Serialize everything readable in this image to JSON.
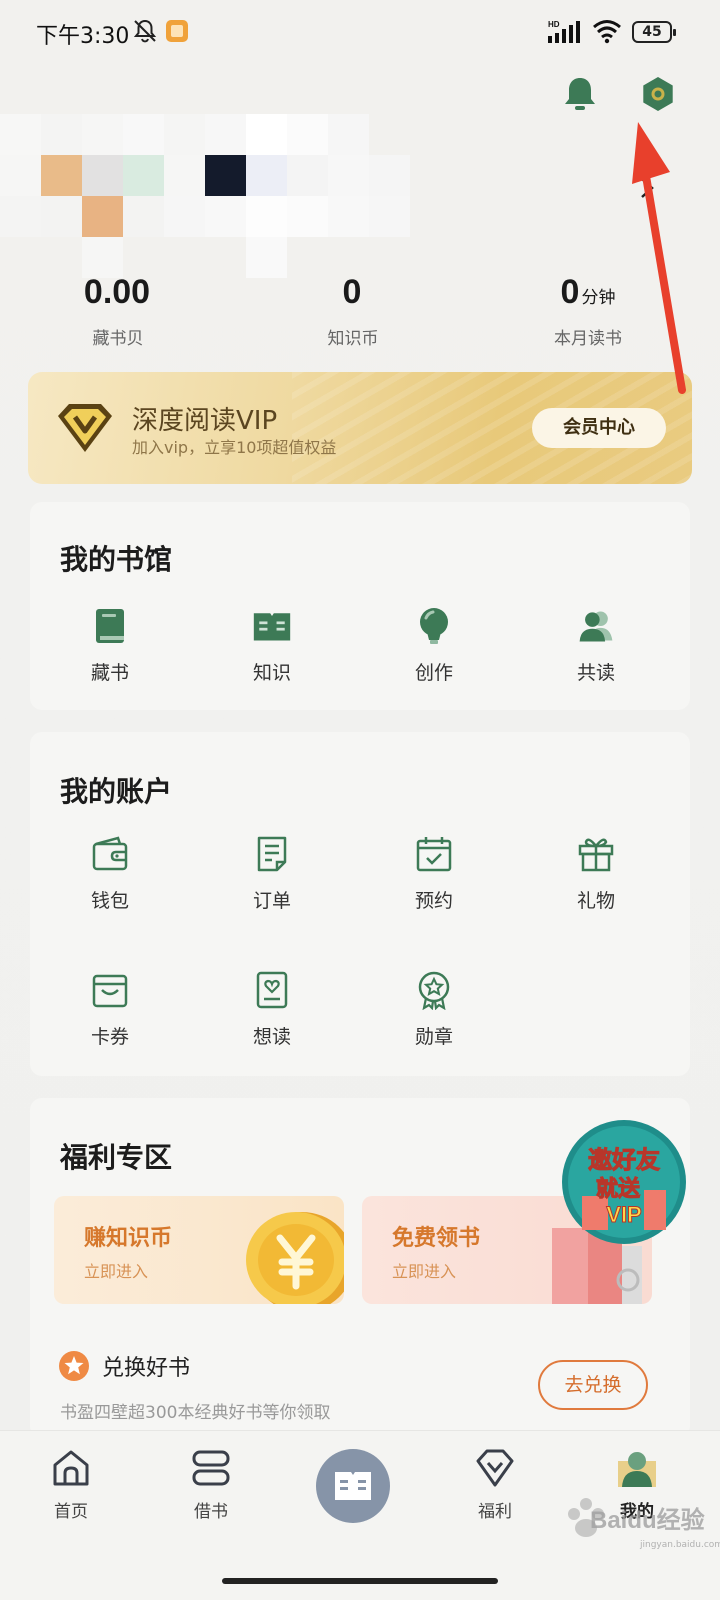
{
  "status_bar": {
    "time": "下午3:30",
    "hd": "HD",
    "battery": "45"
  },
  "stats": [
    {
      "value": "0.00",
      "unit": "",
      "label": "藏书贝"
    },
    {
      "value": "0",
      "unit": "",
      "label": "知识币"
    },
    {
      "value": "0",
      "unit": "分钟",
      "label": "本月读书"
    }
  ],
  "vip": {
    "title": "深度阅读VIP",
    "subtitle": "加入vip，立享10项超值权益",
    "button": "会员中心"
  },
  "library": {
    "title": "我的书馆",
    "items": [
      {
        "label": "藏书",
        "icon": "book-icon"
      },
      {
        "label": "知识",
        "icon": "open-book-icon"
      },
      {
        "label": "创作",
        "icon": "lightbulb-icon"
      },
      {
        "label": "共读",
        "icon": "people-icon"
      }
    ]
  },
  "account": {
    "title": "我的账户",
    "items": [
      {
        "label": "钱包",
        "icon": "wallet-icon"
      },
      {
        "label": "订单",
        "icon": "order-icon"
      },
      {
        "label": "预约",
        "icon": "calendar-check-icon"
      },
      {
        "label": "礼物",
        "icon": "gift-icon"
      },
      {
        "label": "卡券",
        "icon": "coupon-icon"
      },
      {
        "label": "想读",
        "icon": "wishlist-icon"
      },
      {
        "label": "勋章",
        "icon": "medal-icon"
      }
    ]
  },
  "welfare": {
    "title": "福利专区",
    "tiles": [
      {
        "title": "赚知识币",
        "sub": "立即进入"
      },
      {
        "title": "免费领书",
        "sub": "立即进入"
      }
    ],
    "invite_badge": {
      "line1": "邀好友",
      "line2": "就送",
      "line3": "VIP"
    },
    "exchange": {
      "title": "兑换好书",
      "subtitle": "书盈四壁超300本经典好书等你领取",
      "button": "去兑换"
    }
  },
  "bottom_nav": [
    {
      "label": "首页",
      "icon": "home-icon"
    },
    {
      "label": "借书",
      "icon": "borrow-icon"
    },
    {
      "label": "",
      "icon": "reader-icon"
    },
    {
      "label": "福利",
      "icon": "diamond-icon"
    },
    {
      "label": "我的",
      "icon": "profile-icon"
    }
  ],
  "watermark": {
    "text": "Baidu经验",
    "sub": "jingyan.baidu.com"
  },
  "colors": {
    "accent_green": "#3c7a55",
    "vip_gold": "#e8c97a",
    "orange": "#d6782c",
    "annotation_red": "#e8402c"
  }
}
